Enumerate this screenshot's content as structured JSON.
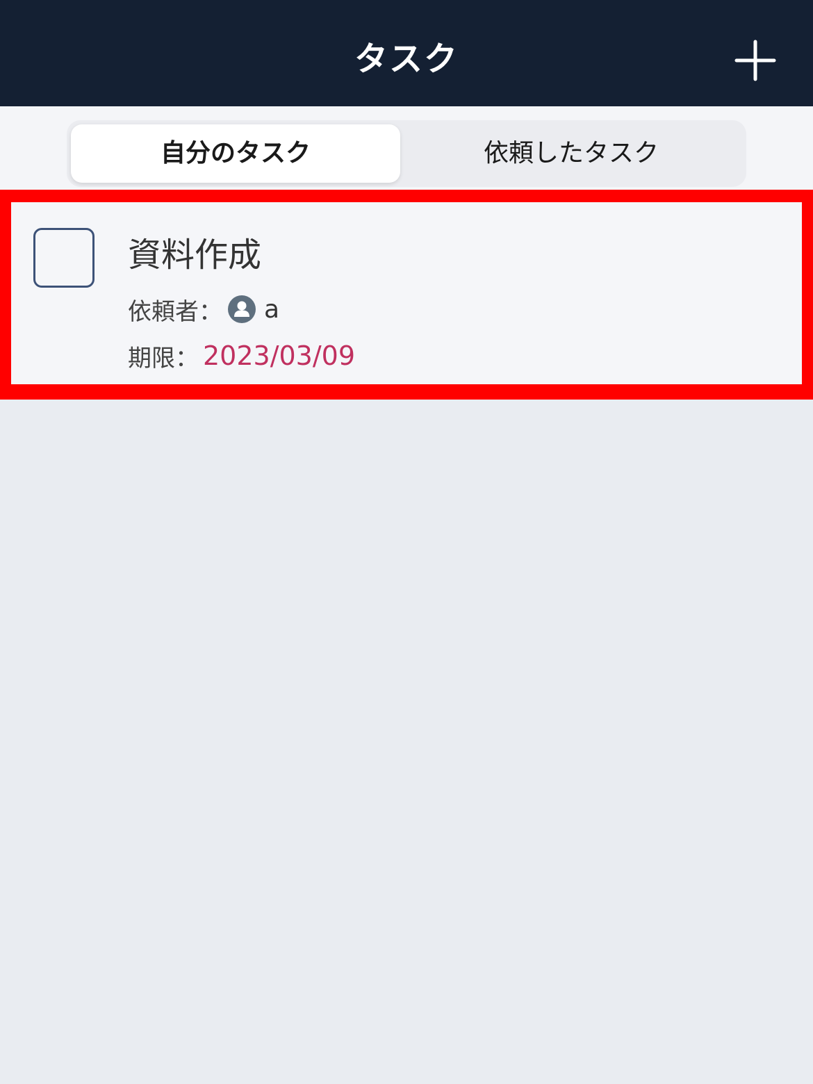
{
  "header": {
    "title": "タスク",
    "add_icon": "plus-icon"
  },
  "tabs": [
    {
      "label": "自分のタスク",
      "selected": true
    },
    {
      "label": "依頼したタスク",
      "selected": false
    }
  ],
  "tasks": [
    {
      "title": "資料作成",
      "completed": false,
      "requester_label": "依頼者：",
      "requester_icon": "user-avatar-icon",
      "requester_name": "a",
      "due_label": "期限：",
      "due_date": "2023/03/09"
    }
  ],
  "colors": {
    "header_bg": "#142033",
    "highlight_border": "#ff0000",
    "due_date": "#c0305f",
    "checkbox_border": "#3d5278"
  }
}
